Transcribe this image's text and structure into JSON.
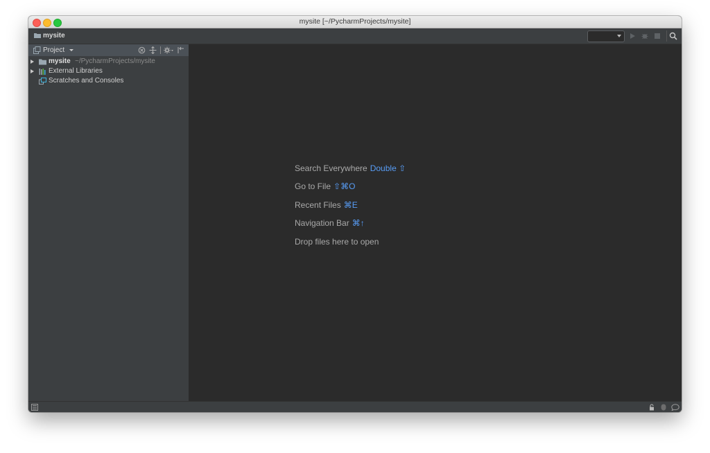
{
  "window": {
    "title": "mysite [~/PycharmProjects/mysite]"
  },
  "navbar": {
    "breadcrumb": "mysite",
    "run_config_value": "",
    "icons": [
      "folder-icon",
      "run-icon",
      "debug-icon",
      "stop-icon",
      "search-icon"
    ]
  },
  "project_panel": {
    "title": "Project",
    "tree": [
      {
        "label": "mysite",
        "path": "~/PycharmProjects/mysite",
        "expandable": true,
        "icon": "folder-icon"
      },
      {
        "label": "External Libraries",
        "expandable": true,
        "icon": "library-icon"
      },
      {
        "label": "Scratches and Consoles",
        "expandable": false,
        "icon": "scratches-icon"
      }
    ]
  },
  "editor": {
    "hints": [
      {
        "label": "Search Everywhere",
        "shortcut": "Double ⇧"
      },
      {
        "label": "Go to File",
        "shortcut": "⇧⌘O"
      },
      {
        "label": "Recent Files",
        "shortcut": "⌘E"
      },
      {
        "label": "Navigation Bar",
        "shortcut": "⌘↑"
      },
      {
        "label": "Drop files here to open",
        "shortcut": ""
      }
    ]
  },
  "colors": {
    "background": "#2b2b2b",
    "panel": "#3c3f41",
    "panel_header": "#4b5157",
    "shortcut_accent": "#589df6",
    "hint_text": "#a9a9a9"
  }
}
